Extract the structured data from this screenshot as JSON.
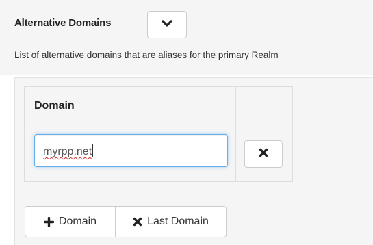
{
  "section": {
    "title": "Alternative Domains",
    "toggle_icon": "chevron-down-icon",
    "description": "List of alternative domains that are aliases for the primary Realm"
  },
  "table": {
    "headers": [
      "Domain",
      ""
    ],
    "rows": [
      {
        "domain_value": "myrpp.net",
        "remove_icon": "times-icon"
      }
    ]
  },
  "actions": {
    "add_label": "Domain",
    "add_icon": "plus-icon",
    "remove_last_label": "Last Domain",
    "remove_last_icon": "times-icon"
  },
  "colors": {
    "focus_border": "#66afe9",
    "panel_bg": "#f5f5f5",
    "border": "#cccccc"
  }
}
